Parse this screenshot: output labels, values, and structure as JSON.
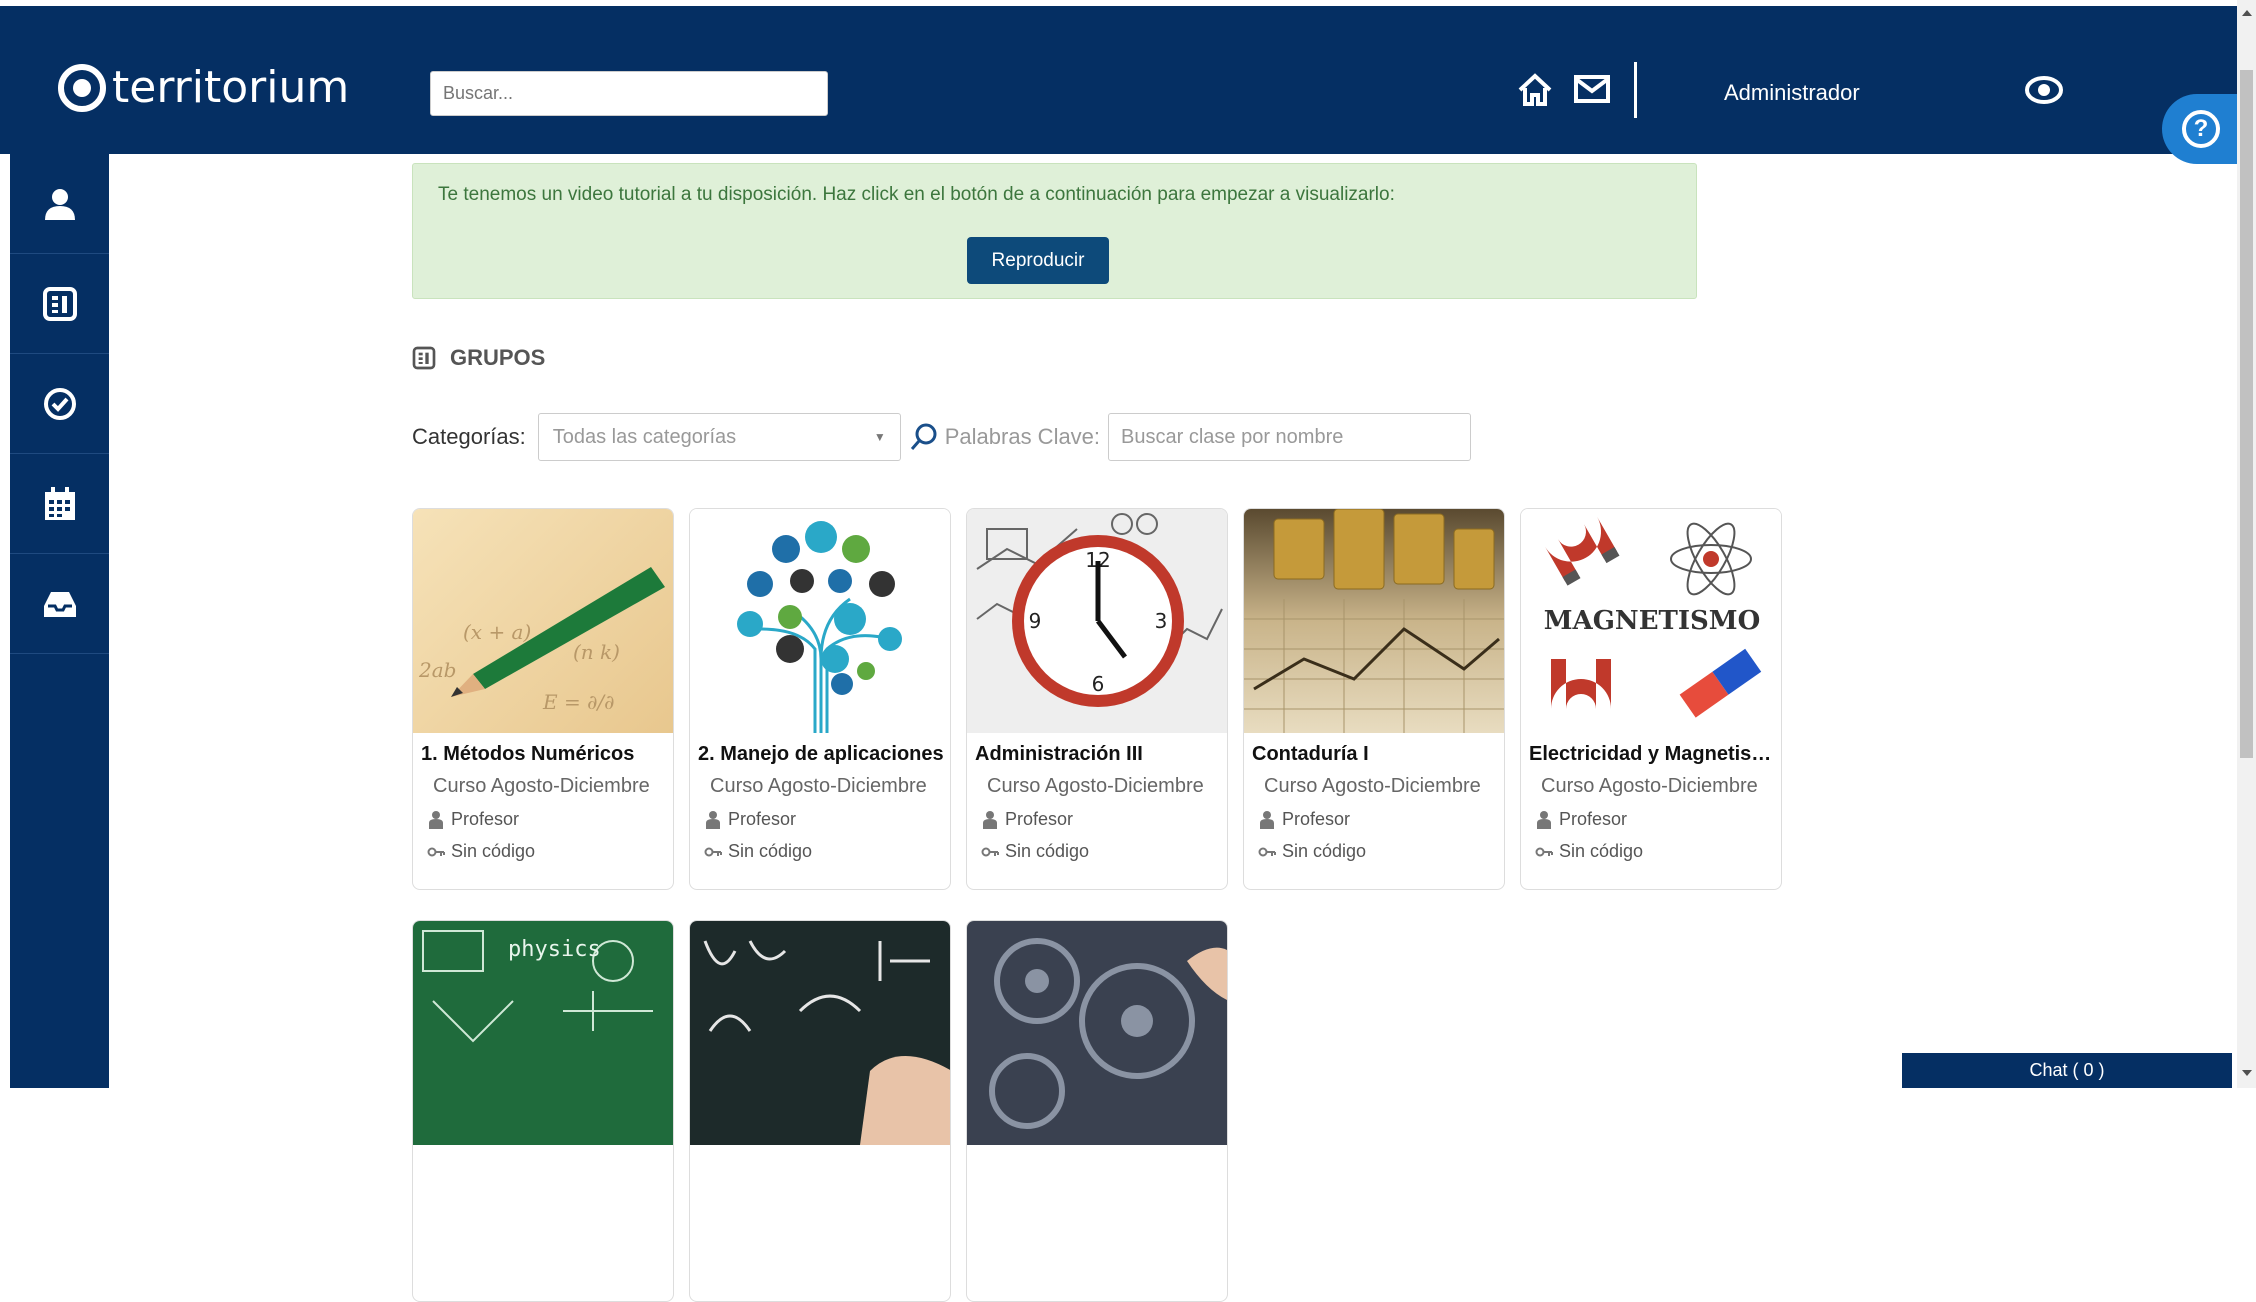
{
  "header": {
    "brand": "territorium",
    "search_placeholder": "Buscar...",
    "user_name": "Administrador",
    "icons": [
      "home-icon",
      "mail-icon",
      "eye-icon",
      "help-icon"
    ]
  },
  "sidebar": {
    "items": [
      {
        "icon": "user-icon"
      },
      {
        "icon": "groups-icon"
      },
      {
        "icon": "check-circle-icon"
      },
      {
        "icon": "calendar-icon"
      },
      {
        "icon": "inbox-icon"
      }
    ]
  },
  "notice": {
    "text": "Te tenemos un video tutorial a tu disposición. Haz click en el botón de a continuación para empezar a visualizarlo:",
    "button_label": "Reproducir"
  },
  "groups": {
    "title": "GRUPOS",
    "categories_label": "Categorías:",
    "categories_value": "Todas las categorías",
    "keywords_label": "Palabras Clave:",
    "keywords_placeholder": "Buscar clase por nombre",
    "cards": [
      {
        "name": "1. Métodos Numéricos",
        "course": "Curso Agosto-Diciembre",
        "role": "Profesor",
        "code": "Sin código"
      },
      {
        "name": "2. Manejo de aplicaciones",
        "course": "Curso Agosto-Diciembre",
        "role": "Profesor",
        "code": "Sin código"
      },
      {
        "name": "Administración III",
        "course": "Curso Agosto-Diciembre",
        "role": "Profesor",
        "code": "Sin código"
      },
      {
        "name": "Contaduría I",
        "course": "Curso Agosto-Diciembre",
        "role": "Profesor",
        "code": "Sin código"
      },
      {
        "name": "Electricidad y Magnetismo",
        "course": "Curso Agosto-Diciembre",
        "role": "Profesor",
        "code": "Sin código",
        "thumb_text": "MAGNETISMO"
      }
    ],
    "second_row_thumb_texts": [
      "physics"
    ]
  },
  "chat": {
    "label": "Chat ( 0 )"
  },
  "colors": {
    "navy": "#052f63",
    "notice_bg": "#dff0d8",
    "button": "#0d4a7a",
    "help": "#1f7fd1"
  }
}
